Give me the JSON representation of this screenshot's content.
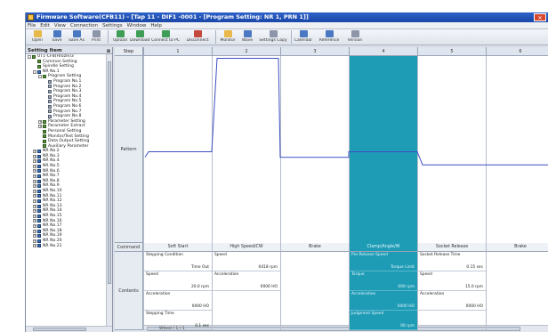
{
  "window": {
    "title": "Firmware Software(CFB11) - [Tap 11 - DIF1 -0001 - [Program Setting: NR 1, PRN 1]]",
    "close_symbol": "✕"
  },
  "menu": [
    "File",
    "Edit",
    "View",
    "Connection",
    "Settings",
    "Window",
    "Help"
  ],
  "toolbar": [
    {
      "label": "Open",
      "icon": "open-icon",
      "color": "#e8b84a"
    },
    {
      "label": "Save",
      "icon": "save-icon",
      "color": "#4a79c2"
    },
    {
      "label": "Save As",
      "icon": "save-as-icon",
      "color": "#4a79c2"
    },
    {
      "label": "Print",
      "icon": "print-icon",
      "color": "#8c96a8"
    },
    {
      "label": "Upload",
      "icon": "upload-icon",
      "color": "#3f9e55"
    },
    {
      "label": "Download",
      "icon": "download-icon",
      "color": "#3f9e55"
    },
    {
      "label": "Connect to PC",
      "icon": "connect-icon",
      "color": "#3f9e55"
    },
    {
      "label": "Disconnect",
      "icon": "disconnect-icon",
      "color": "#c44a3b"
    },
    {
      "label": "Monitor",
      "icon": "monitor-icon",
      "color": "#e8b84a"
    },
    {
      "label": "Wave",
      "icon": "wave-icon",
      "color": "#4a79c2"
    },
    {
      "label": "Settings Copy",
      "icon": "copy-icon",
      "color": "#8c96a8"
    },
    {
      "label": "Calendar",
      "icon": "calendar-icon",
      "color": "#4a79c2"
    },
    {
      "label": "Reference",
      "icon": "reference-icon",
      "color": "#4a79c2"
    },
    {
      "label": "Version",
      "icon": "version-icon",
      "color": "#8c96a8"
    }
  ],
  "tree": {
    "header": "Setting Item",
    "pin_symbol": "⊠",
    "items": [
      {
        "label": "UT1-CFB(Hrozei)3",
        "level": 0,
        "exp": "-",
        "kind": "root"
      },
      {
        "label": "Common Setting",
        "level": 1,
        "exp": "",
        "kind": "node"
      },
      {
        "label": "Spindle Setting",
        "level": 1,
        "exp": "",
        "kind": "node"
      },
      {
        "label": "NR No.1",
        "level": 1,
        "exp": "-",
        "kind": "nr"
      },
      {
        "label": "Program Setting",
        "level": 2,
        "exp": "-",
        "kind": "node"
      },
      {
        "label": "Program No.1",
        "level": 3,
        "exp": "",
        "kind": "prog"
      },
      {
        "label": "Program No.2",
        "level": 3,
        "exp": "",
        "kind": "prog"
      },
      {
        "label": "Program No.3",
        "level": 3,
        "exp": "",
        "kind": "prog"
      },
      {
        "label": "Program No.4",
        "level": 3,
        "exp": "",
        "kind": "prog"
      },
      {
        "label": "Program No.5",
        "level": 3,
        "exp": "",
        "kind": "prog"
      },
      {
        "label": "Program No.6",
        "level": 3,
        "exp": "",
        "kind": "prog"
      },
      {
        "label": "Program No.7",
        "level": 3,
        "exp": "",
        "kind": "prog"
      },
      {
        "label": "Program No.8",
        "level": 3,
        "exp": "",
        "kind": "prog"
      },
      {
        "label": "Parameter Setting",
        "level": 2,
        "exp": "+",
        "kind": "node"
      },
      {
        "label": "Parameter Extract",
        "level": 2,
        "exp": "+",
        "kind": "node"
      },
      {
        "label": "Personal Setting",
        "level": 2,
        "exp": "",
        "kind": "node"
      },
      {
        "label": "Monitor/Test Setting",
        "level": 2,
        "exp": "",
        "kind": "node"
      },
      {
        "label": "Data Output Setting",
        "level": 2,
        "exp": "",
        "kind": "node"
      },
      {
        "label": "Auxiliary Parameter",
        "level": 2,
        "exp": "",
        "kind": "node"
      },
      {
        "label": "NR No.2",
        "level": 1,
        "exp": "+",
        "kind": "nr"
      },
      {
        "label": "NR No.3",
        "level": 1,
        "exp": "+",
        "kind": "nr"
      },
      {
        "label": "NR No.4",
        "level": 1,
        "exp": "+",
        "kind": "nr"
      },
      {
        "label": "NR No.5",
        "level": 1,
        "exp": "+",
        "kind": "nr"
      },
      {
        "label": "NR No.6",
        "level": 1,
        "exp": "+",
        "kind": "nr"
      },
      {
        "label": "NR No.7",
        "level": 1,
        "exp": "+",
        "kind": "nr"
      },
      {
        "label": "NR No.8",
        "level": 1,
        "exp": "+",
        "kind": "nr"
      },
      {
        "label": "NR No.9",
        "level": 1,
        "exp": "+",
        "kind": "nr"
      },
      {
        "label": "NR No.10",
        "level": 1,
        "exp": "+",
        "kind": "nr"
      },
      {
        "label": "NR No.11",
        "level": 1,
        "exp": "+",
        "kind": "nr"
      },
      {
        "label": "NR No.12",
        "level": 1,
        "exp": "+",
        "kind": "nr"
      },
      {
        "label": "NR No.13",
        "level": 1,
        "exp": "+",
        "kind": "nr"
      },
      {
        "label": "NR No.14",
        "level": 1,
        "exp": "+",
        "kind": "nr"
      },
      {
        "label": "NR No.15",
        "level": 1,
        "exp": "+",
        "kind": "nr"
      },
      {
        "label": "NR No.16",
        "level": 1,
        "exp": "+",
        "kind": "nr"
      },
      {
        "label": "NR No.17",
        "level": 1,
        "exp": "+",
        "kind": "nr"
      },
      {
        "label": "NR No.18",
        "level": 1,
        "exp": "+",
        "kind": "nr"
      },
      {
        "label": "NR No.19",
        "level": 1,
        "exp": "+",
        "kind": "nr"
      },
      {
        "label": "NR No.20",
        "level": 1,
        "exp": "+",
        "kind": "nr"
      },
      {
        "label": "NR No.21",
        "level": 1,
        "exp": "+",
        "kind": "nr"
      }
    ]
  },
  "grid": {
    "step_header": "Step",
    "pattern_label": "Pattern",
    "command_label": "Command",
    "contents_label": "Contents",
    "status_text": "Wheel  | 1 / 1",
    "selected_color": "#1e9cb6",
    "columns": [
      {
        "num": "1",
        "command": "Soft Start",
        "selected": false,
        "contents": [
          {
            "k": "Stepping Condition",
            "v": "Time Out"
          },
          {
            "k": "Speed",
            "v": "20.0 rpm"
          },
          {
            "k": "Acceleration",
            "v": "0000 HO"
          },
          {
            "k": "Stepping Time",
            "v": "0.1 sec"
          }
        ]
      },
      {
        "num": "2",
        "command": "High Speed/CW",
        "selected": false,
        "contents": [
          {
            "k": "Speed",
            "v": "0418 rpm"
          },
          {
            "k": "Acceleration",
            "v": "0000 HO"
          }
        ]
      },
      {
        "num": "3",
        "command": "Brake",
        "selected": false,
        "contents": []
      },
      {
        "num": "4",
        "command": "Clamp/Angle/W",
        "selected": true,
        "contents": [
          {
            "k": "Pre-Release Speed",
            "v": "Torque Limit"
          },
          {
            "k": "Torque",
            "v": "000 rpm"
          },
          {
            "k": "Acceleration",
            "v": "0000 HO"
          },
          {
            "k": "Judgment Speed",
            "v": "00 rpm"
          }
        ]
      },
      {
        "num": "5",
        "command": "Socket Release",
        "selected": false,
        "contents": [
          {
            "k": "Socket Release Time",
            "v": "0.15 sec"
          },
          {
            "k": "Speed",
            "v": "15.0 rpm"
          },
          {
            "k": "Acceleration",
            "v": "0000 HO"
          }
        ]
      },
      {
        "num": "6",
        "command": "Brake",
        "selected": false,
        "contents": []
      }
    ],
    "pattern_levels": [
      0.45,
      0.95,
      0.42,
      0.45,
      0.38,
      0.38
    ]
  }
}
